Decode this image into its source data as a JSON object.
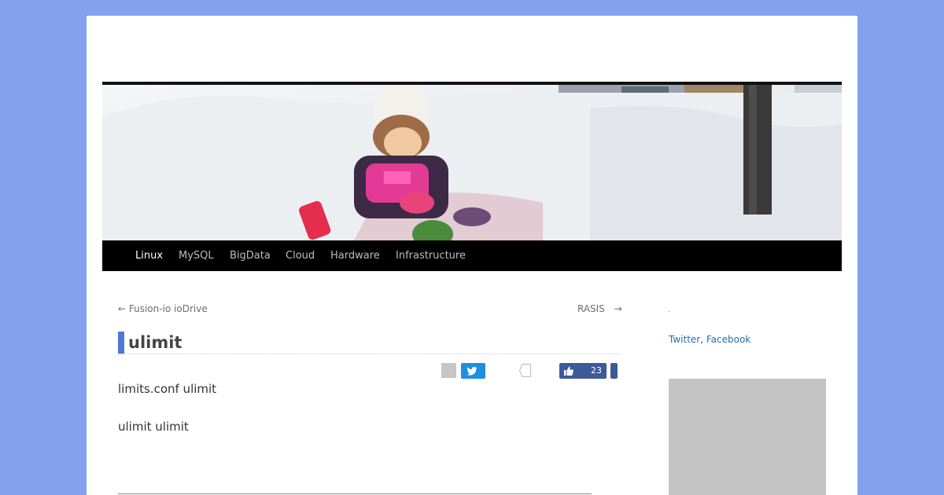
{
  "nav": {
    "items": [
      {
        "label": "Linux",
        "active": true
      },
      {
        "label": "MySQL",
        "active": false
      },
      {
        "label": "BigData",
        "active": false
      },
      {
        "label": "Cloud",
        "active": false
      },
      {
        "label": "Hardware",
        "active": false
      },
      {
        "label": "Infrastructure",
        "active": false
      }
    ]
  },
  "post_nav": {
    "prev_label": "← Fusion-io ioDrive",
    "next_label": "RASIS",
    "next_arrow": "→"
  },
  "post": {
    "title": "ulimit",
    "paragraphs": [
      "limits.conf  ulimit",
      "ulimit ulimit"
    ]
  },
  "share": {
    "like_count": "23",
    "twitter_color": "#1d8fe0",
    "facebook_color": "#3d5a98",
    "icons": [
      "share-placeholder-icon",
      "twitter-icon",
      "hatena-bookmark-icon",
      "thumbs-up-icon"
    ]
  },
  "sidebar": {
    "dot": ".",
    "links": {
      "twitter": "Twitter",
      "separator": ", ",
      "facebook": "Facebook"
    }
  },
  "colors": {
    "background": "#84a0ee",
    "accent": "#4f78d6",
    "nav_background": "#000000"
  }
}
